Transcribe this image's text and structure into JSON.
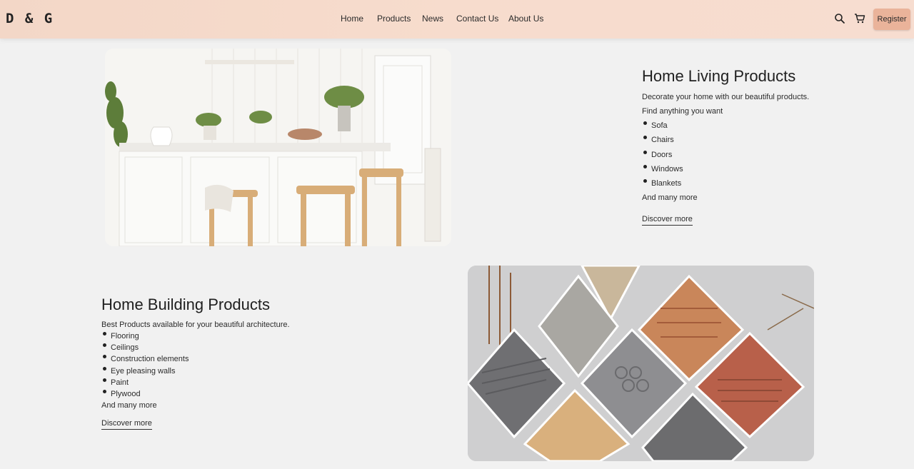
{
  "header": {
    "logo": "D & G",
    "nav": [
      {
        "label": "Home"
      },
      {
        "label": "Products"
      },
      {
        "label": "News"
      },
      {
        "label": "Contact Us"
      },
      {
        "label": "About Us"
      }
    ],
    "register_label": "Register",
    "icons": [
      "search-icon",
      "cart-icon"
    ]
  },
  "living": {
    "title": "Home Living Products",
    "intro1": "Decorate your home with our beautiful products.",
    "intro2": "Find anything you want",
    "items": [
      "Sofa",
      "Chairs",
      "Doors",
      "Windows",
      "Blankets"
    ],
    "outro": "And many more",
    "cta": "Discover more"
  },
  "building": {
    "title": "Home Building Products",
    "intro": "Best Products available for your beautiful architecture.",
    "items": [
      "Flooring",
      "Ceilings",
      "Construction elements",
      "Eye pleasing walls",
      "Paint",
      "Plywood"
    ],
    "outro": "And many more",
    "cta": "Discover more"
  },
  "colors": {
    "header_start": "#f3d7c7",
    "header_end": "#f7ddd0",
    "register_bg": "#eab39a",
    "page_bg": "#f1f1f1"
  }
}
